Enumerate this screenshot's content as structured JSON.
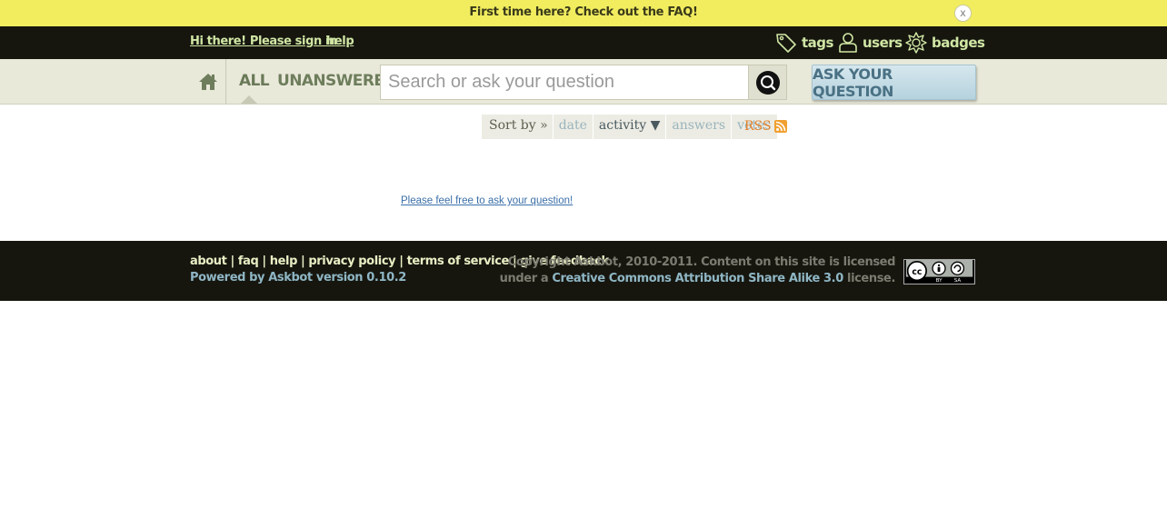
{
  "notify": {
    "text": "First time here? Check out the FAQ!",
    "close_label": "x"
  },
  "header": {
    "signin_label": "Hi there! Please sign in",
    "help_label": "help",
    "nav": [
      {
        "label": "tags",
        "icon": "tag-icon"
      },
      {
        "label": "users",
        "icon": "user-icon"
      },
      {
        "label": "badges",
        "icon": "badge-icon"
      }
    ]
  },
  "secondary": {
    "scopes": [
      "ALL",
      "UNANSWERED"
    ],
    "active_scope": "ALL",
    "search_placeholder": "Search or ask your question",
    "ask_button": "ASK YOUR QUESTION"
  },
  "sort": {
    "label": "Sort by »",
    "options": [
      "date",
      "activity ▼",
      "answers",
      "votes"
    ],
    "active": "activity ▼",
    "rss_label": "RSS"
  },
  "main": {
    "empty_message": "Please feel free to ask your question!"
  },
  "footer": {
    "links": [
      "about",
      "faq",
      "help",
      "privacy policy",
      "terms of service",
      "give feedback"
    ],
    "separator": "|",
    "powered_by": "Powered by Askbot version 0.10.2",
    "copyright_line1": "Copyright Askbot, 2010-2011. Content on this site is licensed",
    "copyright_prefix": "under a",
    "license_link": "Creative Commons Attribution Share Alike 3.0",
    "copyright_suffix": "license.",
    "cc_by": "BY",
    "cc_sa": "SA"
  },
  "colors": {
    "notify_bg": "#f1ed5f",
    "header_bg": "#16160f",
    "header_link": "#d0e6a4",
    "ask_button_text": "#4a7184",
    "rss": "#e0812c"
  }
}
